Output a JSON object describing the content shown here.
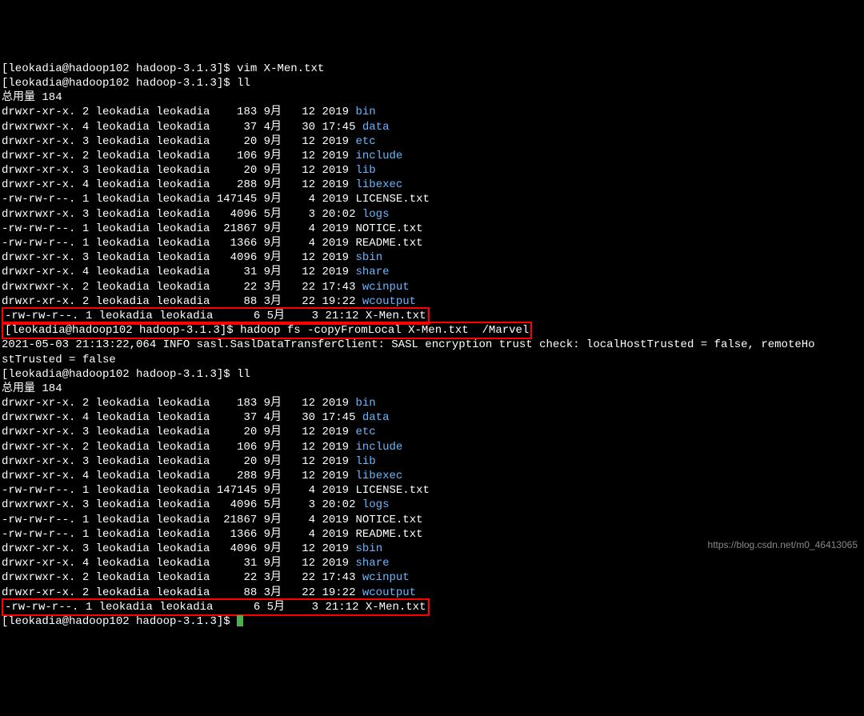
{
  "prompts": {
    "p1": "[leokadia@hadoop102 hadoop-3.1.3]$ ",
    "p2": "[leokadia@hadoop102 hadoop-3.1.3]$ ",
    "p3": "[leokadia@hadoop102 hadoop-3.1.3]$ ",
    "p4": "[leokadia@hadoop102 hadoop-3.1.3]$ ",
    "p5": "[leokadia@hadoop102 hadoop-3.1.3]$ "
  },
  "commands": {
    "c1": "vim X-Men.txt",
    "c2": "ll",
    "c3": "hadoop fs -copyFromLocal X-Men.txt  /Marvel",
    "c4": "ll"
  },
  "total_label1": "总用量 184",
  "total_label2": "总用量 184",
  "sasl_line": "2021-05-03 21:13:22,064 INFO sasl.SaslDataTransferClient: SASL encryption trust check: localHostTrusted = false, remoteHostTrusted = false",
  "sasl_line_wrap": "stTrusted = false",
  "listing1": [
    {
      "perm": "drwxr-xr-x.",
      "links": "2",
      "owner": "leokadia",
      "group": "leokadia",
      "size": "   183",
      "month": "9月",
      "day": "  12",
      "time": "2019",
      "name": "bin",
      "dir": true
    },
    {
      "perm": "drwxrwxr-x.",
      "links": "4",
      "owner": "leokadia",
      "group": "leokadia",
      "size": "    37",
      "month": "4月",
      "day": "  30",
      "time": "17:45",
      "name": "data",
      "dir": true
    },
    {
      "perm": "drwxr-xr-x.",
      "links": "3",
      "owner": "leokadia",
      "group": "leokadia",
      "size": "    20",
      "month": "9月",
      "day": "  12",
      "time": "2019",
      "name": "etc",
      "dir": true
    },
    {
      "perm": "drwxr-xr-x.",
      "links": "2",
      "owner": "leokadia",
      "group": "leokadia",
      "size": "   106",
      "month": "9月",
      "day": "  12",
      "time": "2019",
      "name": "include",
      "dir": true
    },
    {
      "perm": "drwxr-xr-x.",
      "links": "3",
      "owner": "leokadia",
      "group": "leokadia",
      "size": "    20",
      "month": "9月",
      "day": "  12",
      "time": "2019",
      "name": "lib",
      "dir": true
    },
    {
      "perm": "drwxr-xr-x.",
      "links": "4",
      "owner": "leokadia",
      "group": "leokadia",
      "size": "   288",
      "month": "9月",
      "day": "  12",
      "time": "2019",
      "name": "libexec",
      "dir": true
    },
    {
      "perm": "-rw-rw-r--.",
      "links": "1",
      "owner": "leokadia",
      "group": "leokadia",
      "size": "147145",
      "month": "9月",
      "day": "   4",
      "time": "2019",
      "name": "LICENSE.txt",
      "dir": false
    },
    {
      "perm": "drwxrwxr-x.",
      "links": "3",
      "owner": "leokadia",
      "group": "leokadia",
      "size": "  4096",
      "month": "5月",
      "day": "   3",
      "time": "20:02",
      "name": "logs",
      "dir": true
    },
    {
      "perm": "-rw-rw-r--.",
      "links": "1",
      "owner": "leokadia",
      "group": "leokadia",
      "size": " 21867",
      "month": "9月",
      "day": "   4",
      "time": "2019",
      "name": "NOTICE.txt",
      "dir": false
    },
    {
      "perm": "-rw-rw-r--.",
      "links": "1",
      "owner": "leokadia",
      "group": "leokadia",
      "size": "  1366",
      "month": "9月",
      "day": "   4",
      "time": "2019",
      "name": "README.txt",
      "dir": false
    },
    {
      "perm": "drwxr-xr-x.",
      "links": "3",
      "owner": "leokadia",
      "group": "leokadia",
      "size": "  4096",
      "month": "9月",
      "day": "  12",
      "time": "2019",
      "name": "sbin",
      "dir": true
    },
    {
      "perm": "drwxr-xr-x.",
      "links": "4",
      "owner": "leokadia",
      "group": "leokadia",
      "size": "    31",
      "month": "9月",
      "day": "  12",
      "time": "2019",
      "name": "share",
      "dir": true
    },
    {
      "perm": "drwxrwxr-x.",
      "links": "2",
      "owner": "leokadia",
      "group": "leokadia",
      "size": "    22",
      "month": "3月",
      "day": "  22",
      "time": "17:43",
      "name": "wcinput",
      "dir": true
    },
    {
      "perm": "drwxr-xr-x.",
      "links": "2",
      "owner": "leokadia",
      "group": "leokadia",
      "size": "    88",
      "month": "3月",
      "day": "  22",
      "time": "19:22",
      "name": "wcoutput",
      "dir": true
    },
    {
      "perm": "-rw-rw-r--.",
      "links": "1",
      "owner": "leokadia",
      "group": "leokadia",
      "size": "     6",
      "month": "5月",
      "day": "   3",
      "time": "21:12",
      "name": "X-Men.txt",
      "dir": false,
      "highlight": true
    }
  ],
  "listing2": [
    {
      "perm": "drwxr-xr-x.",
      "links": "2",
      "owner": "leokadia",
      "group": "leokadia",
      "size": "   183",
      "month": "9月",
      "day": "  12",
      "time": "2019",
      "name": "bin",
      "dir": true
    },
    {
      "perm": "drwxrwxr-x.",
      "links": "4",
      "owner": "leokadia",
      "group": "leokadia",
      "size": "    37",
      "month": "4月",
      "day": "  30",
      "time": "17:45",
      "name": "data",
      "dir": true
    },
    {
      "perm": "drwxr-xr-x.",
      "links": "3",
      "owner": "leokadia",
      "group": "leokadia",
      "size": "    20",
      "month": "9月",
      "day": "  12",
      "time": "2019",
      "name": "etc",
      "dir": true
    },
    {
      "perm": "drwxr-xr-x.",
      "links": "2",
      "owner": "leokadia",
      "group": "leokadia",
      "size": "   106",
      "month": "9月",
      "day": "  12",
      "time": "2019",
      "name": "include",
      "dir": true
    },
    {
      "perm": "drwxr-xr-x.",
      "links": "3",
      "owner": "leokadia",
      "group": "leokadia",
      "size": "    20",
      "month": "9月",
      "day": "  12",
      "time": "2019",
      "name": "lib",
      "dir": true
    },
    {
      "perm": "drwxr-xr-x.",
      "links": "4",
      "owner": "leokadia",
      "group": "leokadia",
      "size": "   288",
      "month": "9月",
      "day": "  12",
      "time": "2019",
      "name": "libexec",
      "dir": true
    },
    {
      "perm": "-rw-rw-r--.",
      "links": "1",
      "owner": "leokadia",
      "group": "leokadia",
      "size": "147145",
      "month": "9月",
      "day": "   4",
      "time": "2019",
      "name": "LICENSE.txt",
      "dir": false
    },
    {
      "perm": "drwxrwxr-x.",
      "links": "3",
      "owner": "leokadia",
      "group": "leokadia",
      "size": "  4096",
      "month": "5月",
      "day": "   3",
      "time": "20:02",
      "name": "logs",
      "dir": true
    },
    {
      "perm": "-rw-rw-r--.",
      "links": "1",
      "owner": "leokadia",
      "group": "leokadia",
      "size": " 21867",
      "month": "9月",
      "day": "   4",
      "time": "2019",
      "name": "NOTICE.txt",
      "dir": false
    },
    {
      "perm": "-rw-rw-r--.",
      "links": "1",
      "owner": "leokadia",
      "group": "leokadia",
      "size": "  1366",
      "month": "9月",
      "day": "   4",
      "time": "2019",
      "name": "README.txt",
      "dir": false
    },
    {
      "perm": "drwxr-xr-x.",
      "links": "3",
      "owner": "leokadia",
      "group": "leokadia",
      "size": "  4096",
      "month": "9月",
      "day": "  12",
      "time": "2019",
      "name": "sbin",
      "dir": true
    },
    {
      "perm": "drwxr-xr-x.",
      "links": "4",
      "owner": "leokadia",
      "group": "leokadia",
      "size": "    31",
      "month": "9月",
      "day": "  12",
      "time": "2019",
      "name": "share",
      "dir": true
    },
    {
      "perm": "drwxrwxr-x.",
      "links": "2",
      "owner": "leokadia",
      "group": "leokadia",
      "size": "    22",
      "month": "3月",
      "day": "  22",
      "time": "17:43",
      "name": "wcinput",
      "dir": true
    },
    {
      "perm": "drwxr-xr-x.",
      "links": "2",
      "owner": "leokadia",
      "group": "leokadia",
      "size": "    88",
      "month": "3月",
      "day": "  22",
      "time": "19:22",
      "name": "wcoutput",
      "dir": true
    },
    {
      "perm": "-rw-rw-r--.",
      "links": "1",
      "owner": "leokadia",
      "group": "leokadia",
      "size": "     6",
      "month": "5月",
      "day": "   3",
      "time": "21:12",
      "name": "X-Men.txt",
      "dir": false,
      "highlight": true
    }
  ],
  "sasl_full": "2021-05-03 21:13:22,064 INFO sasl.SaslDataTransferClient: SASL encryption trust check: localHostTrusted = false, remoteHo",
  "watermark": "https://blog.csdn.net/m0_46413065"
}
